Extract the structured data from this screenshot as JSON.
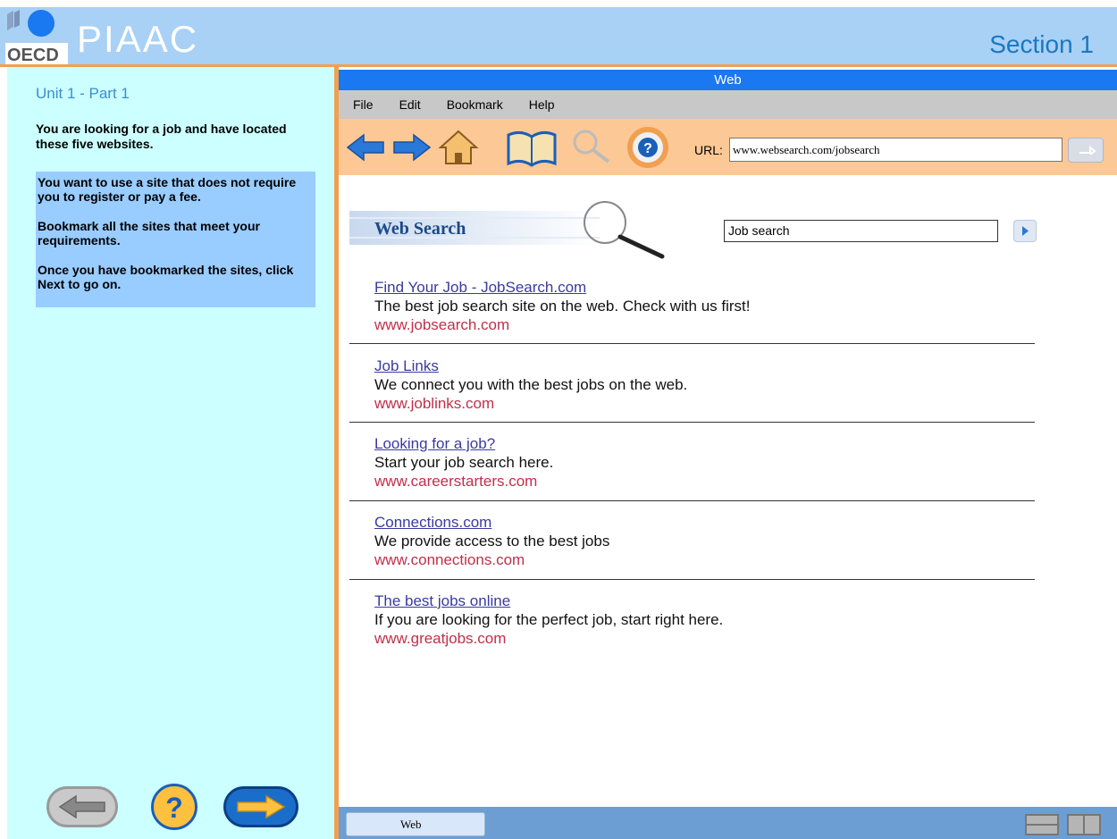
{
  "header": {
    "logo_text": "OECD",
    "brand": "PIAAC",
    "section": "Section 1"
  },
  "left_panel": {
    "unit_title": "Unit 1 - Part 1",
    "intro": "You are looking for a job and have located these five websites.",
    "instructions": [
      "You want to use a site that does not require you to register or pay a fee.",
      "Bookmark all the sites that meet your requirements.",
      "Once you have bookmarked the sites, click Next to go on."
    ]
  },
  "browser": {
    "title": "Web",
    "menu": [
      "File",
      "Edit",
      "Bookmark",
      "Help"
    ],
    "url_label": "URL:",
    "url_value": "www.websearch.com/jobsearch",
    "icons": [
      "back-arrow-icon",
      "forward-arrow-icon",
      "home-icon",
      "bookmark-book-icon",
      "search-magnifier-icon",
      "help-lifebuoy-icon"
    ]
  },
  "web_search": {
    "title": "Web Search",
    "query": "Job search"
  },
  "results": [
    {
      "title": "Find Your Job - JobSearch.com",
      "description": "The best job search site on the web.  Check with us first!",
      "url": "www.jobsearch.com"
    },
    {
      "title": "Job Links",
      "description": "We connect you with the best jobs on the web.",
      "url": "www.joblinks.com"
    },
    {
      "title": "Looking for a job?",
      "description": "Start your job search here.",
      "url": "www.careerstarters.com"
    },
    {
      "title": "Connections.com",
      "description": "We provide access to the best jobs",
      "url": "www.connections.com"
    },
    {
      "title": "The best jobs online",
      "description": "If you are looking for the perfect job, start right here.",
      "url": "www.greatjobs.com"
    }
  ],
  "taskbar": {
    "web_tab": "Web"
  },
  "colors": {
    "header_bg": "#a9d0f5",
    "accent_orange": "#f0a050",
    "left_panel_bg": "#ccffff",
    "instruction_bg": "#99ccff",
    "titlebar_blue": "#1a78f0",
    "link_color": "#3a3aa0",
    "url_color": "#c0304a"
  }
}
